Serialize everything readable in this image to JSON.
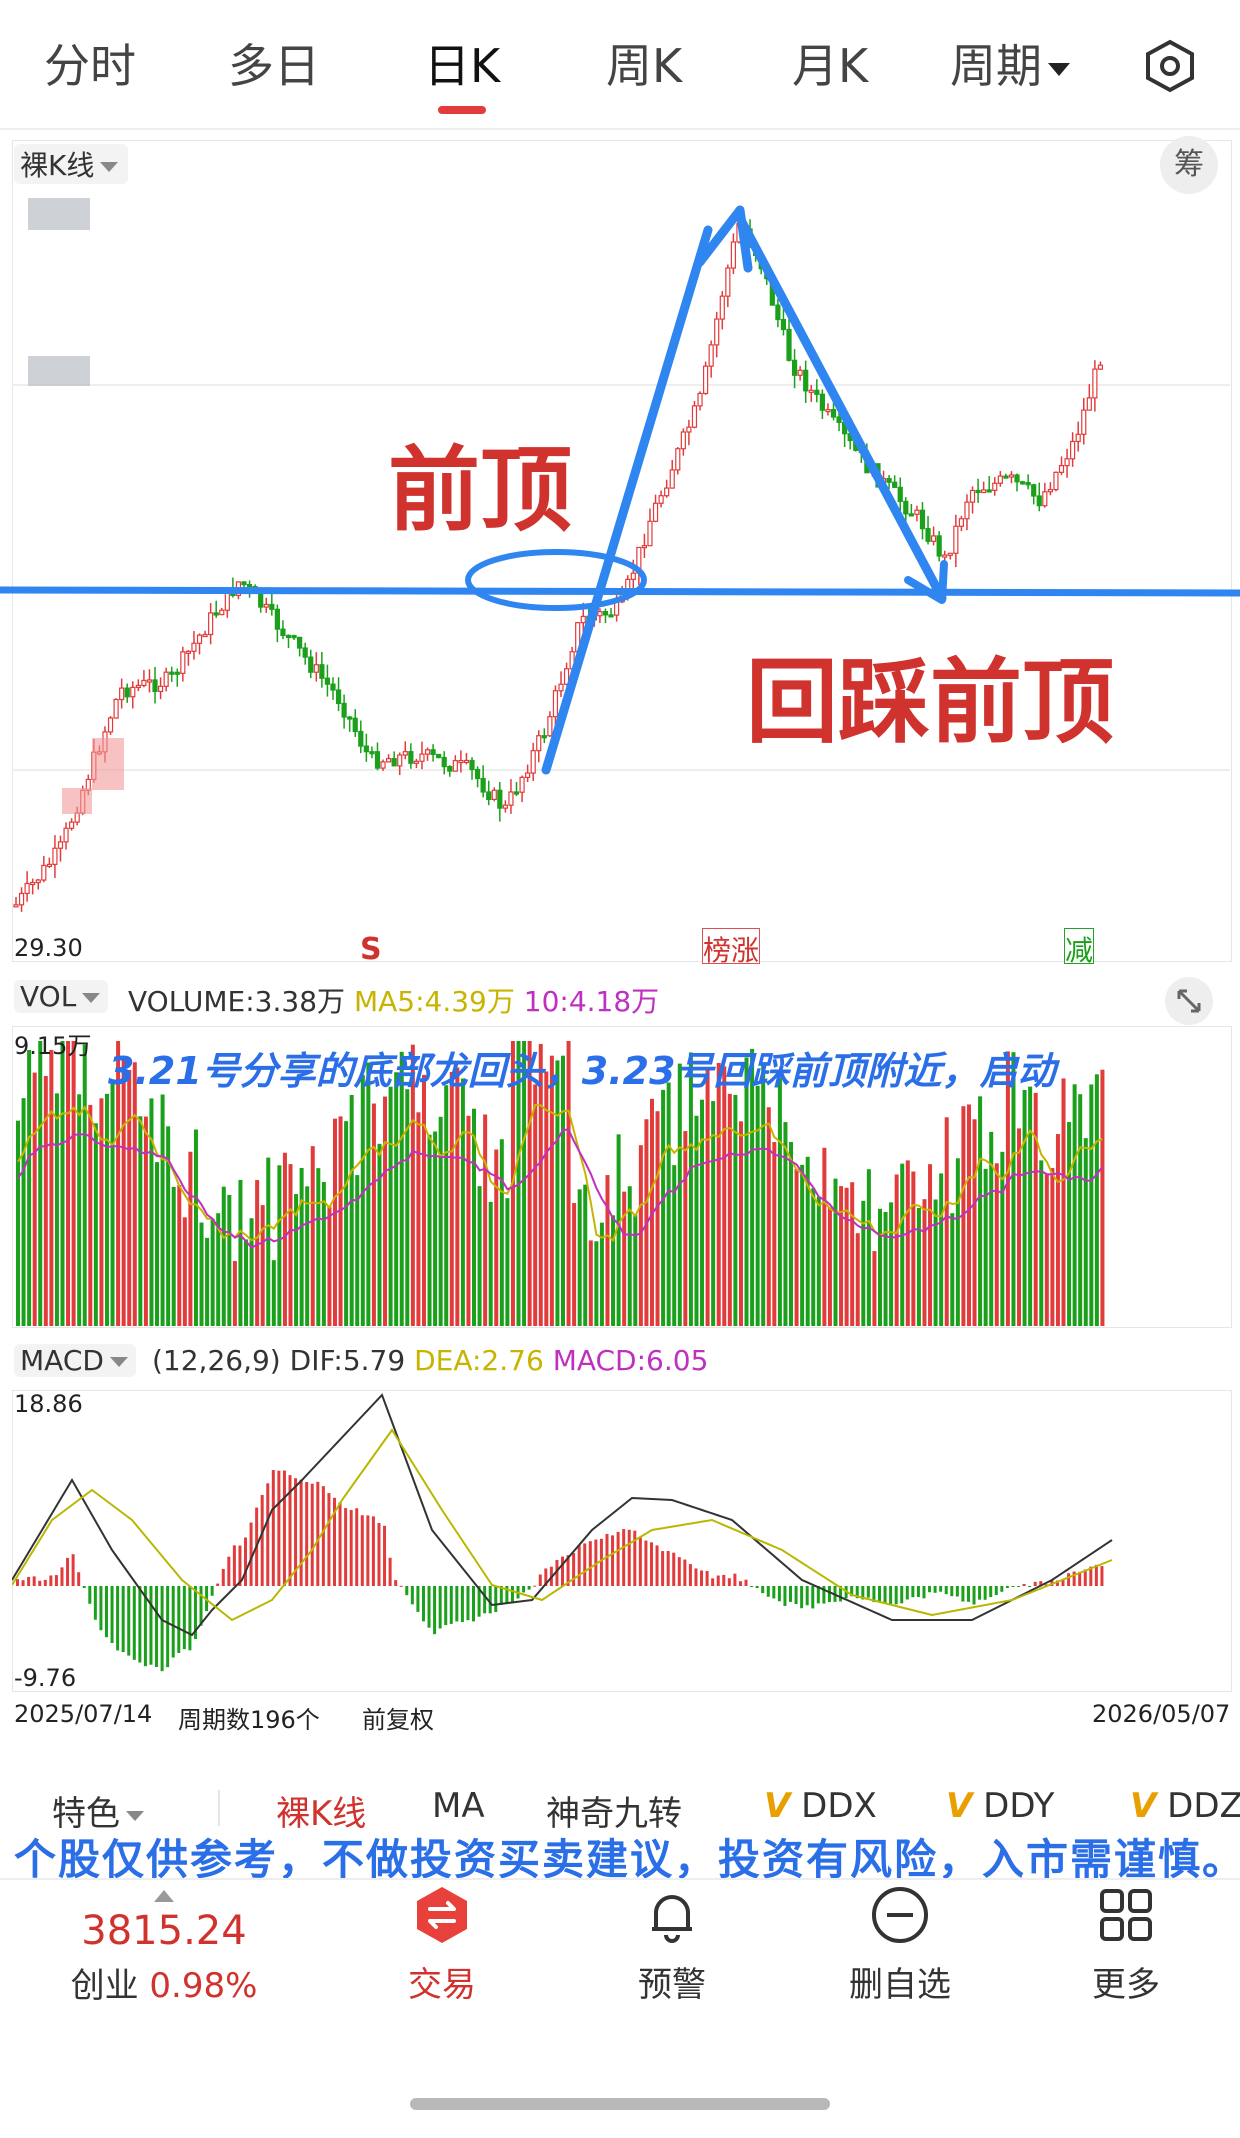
{
  "tabs": [
    {
      "label": "分时"
    },
    {
      "label": "多日"
    },
    {
      "label": "日K"
    },
    {
      "label": "周K"
    },
    {
      "label": "月K"
    },
    {
      "label": "周期"
    }
  ],
  "kline": {
    "mode_label": "裸K线",
    "chip_label": "筹",
    "low_price": "29.30",
    "annotation_qianding": "前顶",
    "annotation_huicai": "回踩前顶",
    "signal_s": "S",
    "marker_bang": "榜",
    "marker_zhang": "涨",
    "marker_jian": "减"
  },
  "volume": {
    "label": "VOL",
    "volume": "VOLUME:3.38万",
    "ma5": "MA5:4.39万",
    "ma10": "10:4.18万",
    "max": "9.15万",
    "note": "3.21号分享的底部龙回头，3.23号回踩前顶附近，启动"
  },
  "macd": {
    "label": "MACD",
    "params": "(12,26,9)",
    "dif": "DIF:5.79",
    "dea": "DEA:2.76",
    "macd": "MACD:6.05",
    "max": "18.86",
    "min": "-9.76"
  },
  "range": {
    "start": "2025/07/14",
    "count": "周期数196个",
    "adjust": "前复权",
    "end": "2026/05/07"
  },
  "indicators": [
    {
      "label": "特色"
    },
    {
      "label": "裸K线"
    },
    {
      "label": "MA"
    },
    {
      "label": "神奇九转"
    },
    {
      "label": "DDX"
    },
    {
      "label": "DDY"
    },
    {
      "label": "DDZ"
    }
  ],
  "indicator_v_badge": "V",
  "disclaimer": "个股仅供参考，不做投资买卖建议，投资有风险，入市需谨慎。",
  "bottom_nav": {
    "index_value": "3815.24",
    "index_name": "创业",
    "index_change": "0.98%",
    "trade": "交易",
    "alert": "预警",
    "remove": "删自选",
    "more": "更多"
  },
  "colors": {
    "up": "#e23b3b",
    "down": "#1aa01a",
    "annotation_line": "#2f86f0",
    "annotation_text": "#d0322d",
    "note_text": "#2a6ee8",
    "ma5": "#c8b400",
    "ma10": "#c030c0"
  }
}
